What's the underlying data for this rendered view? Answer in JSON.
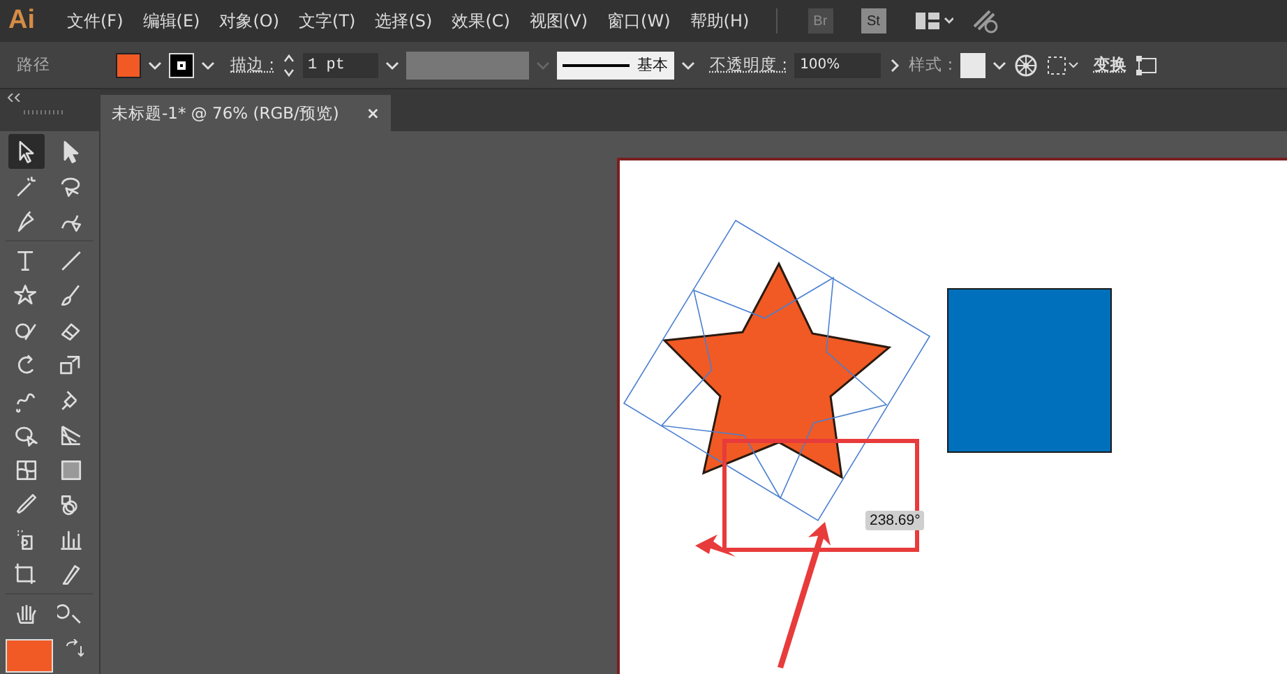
{
  "app": {
    "logo": "Ai"
  },
  "menu": [
    "文件(F)",
    "编辑(E)",
    "对象(O)",
    "文字(T)",
    "选择(S)",
    "效果(C)",
    "视图(V)",
    "窗口(W)",
    "帮助(H)"
  ],
  "app_buttons": [
    "Br",
    "St"
  ],
  "control_bar": {
    "selection_label": "路径",
    "fill": {
      "color": "#f15a24"
    },
    "stroke": {
      "color": "#000000"
    },
    "stroke_label": "描边 :",
    "stroke_weight": "1 pt",
    "profile": "基本",
    "opacity_label": "不透明度 :",
    "opacity": "100%",
    "style_label": "样式 :",
    "transform": "变换"
  },
  "document_tab": {
    "title": "未标题-1* @ 76% (RGB/预览)",
    "close": "×"
  },
  "tools": [
    {
      "selected": true
    },
    {
      "selected": false
    },
    {
      "selected": false
    },
    {
      "selected": false
    },
    {
      "selected": false
    },
    {
      "selected": false
    },
    {
      "selected": false
    },
    {
      "selected": false
    },
    {
      "selected": false
    },
    {
      "selected": false
    },
    {
      "selected": false
    },
    {
      "selected": false
    },
    {
      "selected": false
    },
    {
      "selected": false
    },
    {
      "selected": false
    },
    {
      "selected": false
    },
    {
      "selected": false
    },
    {
      "selected": false
    },
    {
      "selected": false
    },
    {
      "selected": false
    },
    {
      "selected": false
    },
    {
      "selected": false
    },
    {
      "selected": false
    },
    {
      "selected": false
    },
    {
      "selected": false
    },
    {
      "selected": false
    },
    {
      "selected": false
    },
    {
      "selected": false
    }
  ],
  "canvas": {
    "angle_tooltip": "238.69°"
  }
}
